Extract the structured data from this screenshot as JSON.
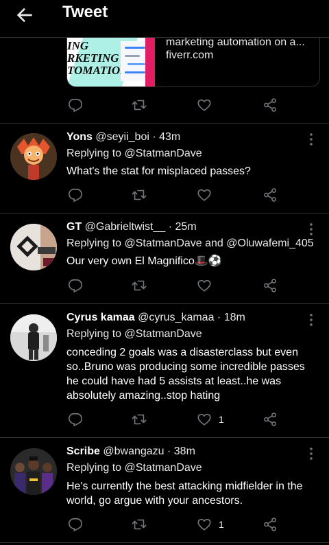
{
  "header": {
    "title": "Tweet"
  },
  "link_card": {
    "image_text": "ING\nRKETING\nTOMATIONS",
    "title": "marketing automation on a...",
    "domain": "fiverr.com"
  },
  "tweets": [
    {
      "name": "Yons",
      "handle": "@seyii_boi",
      "time": " · 43m",
      "replying_prefix": "Replying to ",
      "mention1": "@StatmanDave",
      "mention_joiner": "",
      "mention2": "",
      "text": "What's the stat for misplaced passes?",
      "like_count": ""
    },
    {
      "name": "GT",
      "handle": "@Gabrieltwist__",
      "time": " · 25m",
      "replying_prefix": "Replying to ",
      "mention1": "@StatmanDave",
      "mention_joiner": " and ",
      "mention2": "@Oluwafemi_405",
      "text": "Our very own El Magnifico🎩⚽",
      "like_count": ""
    },
    {
      "name": "Cyrus kamaa",
      "handle": "@cyrus_kamaa",
      "time": " · 18m",
      "replying_prefix": "Replying to ",
      "mention1": "@StatmanDave",
      "mention_joiner": "",
      "mention2": "",
      "text": "conceding 2 goals was a disasterclass but even so..Bruno was producing some incredible passes he could have had 5 assists at least..he was absolutely amazing..stop hating",
      "like_count": "1"
    },
    {
      "name": "Scribe",
      "handle": "@bwangazu",
      "time": " · 38m",
      "replying_prefix": "Replying to ",
      "mention1": "@StatmanDave",
      "mention_joiner": "",
      "mention2": "",
      "text": "He's currently the best attacking midfielder in the world, go argue with your ancestors.",
      "like_count": "1"
    }
  ],
  "icons": {
    "reply": "reply-icon",
    "retweet": "retweet-icon",
    "like": "heart-icon",
    "share": "share-icon",
    "more": "more-icon",
    "back": "back-arrow-icon"
  },
  "colors": {
    "background": "#000000",
    "text": "#e7e9ea",
    "divider": "#2f3336",
    "icon": "#71767b"
  }
}
